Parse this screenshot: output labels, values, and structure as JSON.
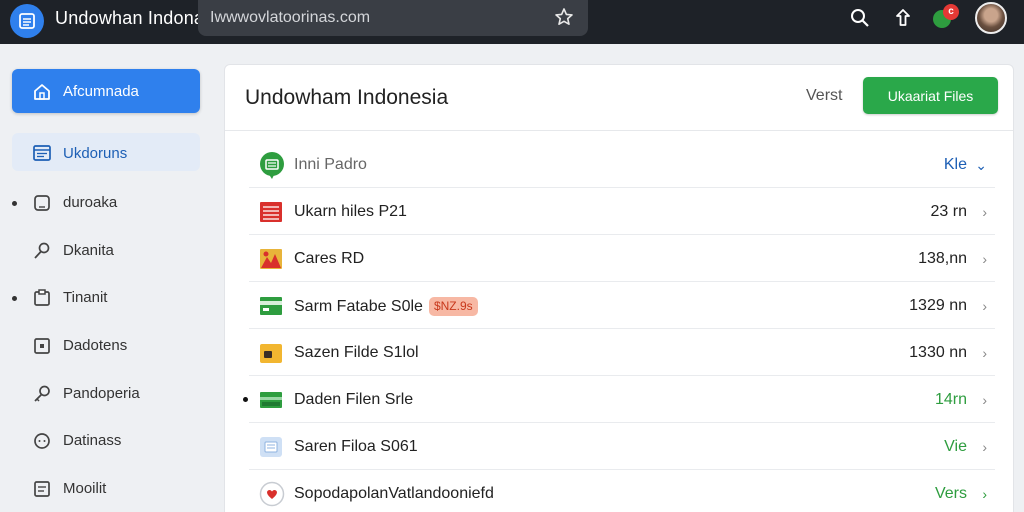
{
  "app": {
    "title": "Undowhan  Indona"
  },
  "browser": {
    "url": "Iwwwovlatoorinas.com"
  },
  "toolbar": {
    "notification_count": "c"
  },
  "sidebar": {
    "items": [
      {
        "label": "Afcumnada",
        "icon": "home-icon"
      },
      {
        "label": "Ukdoruns",
        "icon": "calendar-icon"
      },
      {
        "label": "duroaka",
        "icon": "tablet-icon"
      },
      {
        "label": "Dkanita",
        "icon": "search-icon"
      },
      {
        "label": "Tinanit",
        "icon": "clipboard-icon"
      },
      {
        "label": "Dadotens",
        "icon": "document-icon"
      },
      {
        "label": "Pandoperia",
        "icon": "key-icon"
      },
      {
        "label": "Datinass",
        "icon": "chat-icon"
      },
      {
        "label": "Mooilit",
        "icon": "image-icon"
      }
    ]
  },
  "main": {
    "title": "Undowham Indonesia",
    "header_link": "Verst",
    "primary_button": "Ukaariat Files",
    "rows": [
      {
        "name": "Inni Padro",
        "value": "Kle",
        "icon": "chat-bubble-icon"
      },
      {
        "name": "Ukarn hiles P21",
        "value": "23 rn",
        "icon": "spreadsheet-icon"
      },
      {
        "name": "Cares RD",
        "value": "138,nn",
        "icon": "photo-icon"
      },
      {
        "name": "Sarm Fatabe S0le",
        "tag": "$NZ.9s",
        "value": "1329 nn",
        "icon": "card-icon"
      },
      {
        "name": "Sazen Filde S1lol",
        "value": "1330 nn",
        "icon": "folder-icon"
      },
      {
        "name": "Daden Filen Srle",
        "value": "14rn",
        "icon": "money-icon"
      },
      {
        "name": "Saren Filoa S061",
        "value": "Vie",
        "icon": "file-icon"
      },
      {
        "name": "SopodapolanVatlandooniefd",
        "value": "Vers",
        "icon": "heart-icon"
      }
    ]
  },
  "colors": {
    "topbar": "#1e2228",
    "accent_blue": "#2f80ed",
    "primary_green": "#2aa84a",
    "tag_bg": "#f7b8a4"
  }
}
